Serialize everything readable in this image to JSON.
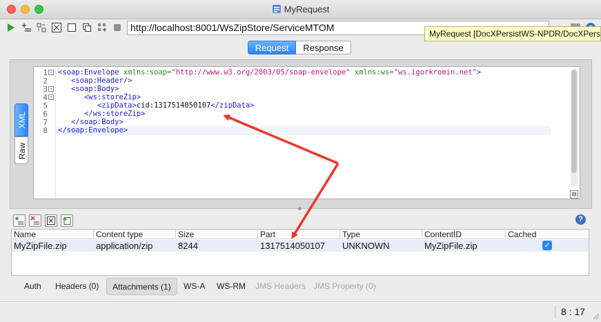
{
  "window": {
    "title": "MyRequest"
  },
  "toolbar": {
    "url": "http://localhost:8001/WsZipStore/ServiceMTOM",
    "tooltip": "MyRequest [DocXPersistWS-NPDR/DocXPersist"
  },
  "request_tabs": [
    "Request",
    "Response"
  ],
  "editor": {
    "side_tabs": [
      "XML",
      "Raw"
    ],
    "line_numbers": [
      "1",
      "2",
      "3",
      "4",
      "5",
      "6",
      "7",
      "8"
    ],
    "lines": [
      "<soap:Envelope xmlns:soap=\"http://www.w3.org/2003/05/soap-envelope\" xmlns:ws=\"ws.igorkromin.net\">",
      "   <soap:Header/>",
      "   <soap:Body>",
      "      <ws:storeZip>",
      "         <zipData>cid:1317514050107</zipData>",
      "      </ws:storeZip>",
      "   </soap:Body>",
      "</soap:Envelope>"
    ]
  },
  "attachments": {
    "columns": [
      "Name",
      "Content type",
      "Size",
      "Part",
      "Type",
      "ContentID",
      "Cached"
    ],
    "rows": [
      {
        "name": "MyZipFile.zip",
        "content_type": "application/zip",
        "size": "8244",
        "part": "1317514050107",
        "type": "UNKNOWN",
        "content_id": "MyZipFile.zip",
        "cached": true
      }
    ],
    "help": "?"
  },
  "bottom_tabs": [
    {
      "label": "Auth",
      "state": "normal"
    },
    {
      "label": "Headers (0)",
      "state": "normal"
    },
    {
      "label": "Attachments (1)",
      "state": "active"
    },
    {
      "label": "WS-A",
      "state": "normal"
    },
    {
      "label": "WS-RM",
      "state": "normal"
    },
    {
      "label": "JMS Headers",
      "state": "disabled"
    },
    {
      "label": "JMS Property (0)",
      "state": "disabled"
    }
  ],
  "status": {
    "cursor_position": "8 : 17"
  },
  "colors": {
    "accent": "#2a86f1",
    "annotation_arrow": "#e8382a",
    "tag": "#1a1ad6",
    "attr": "#2a8a2a",
    "string": "#c2187a"
  }
}
